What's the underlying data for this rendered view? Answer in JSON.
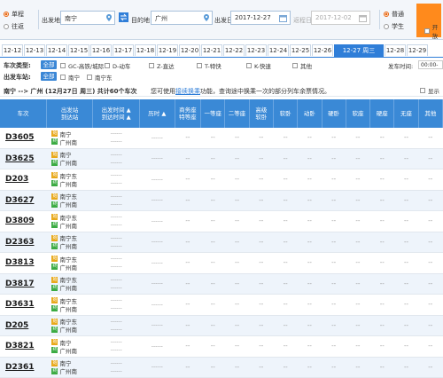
{
  "trip_type": {
    "options": [
      "单程",
      "往返"
    ],
    "selected": "单程"
  },
  "search": {
    "from_label": "出发地",
    "from_value": "南宁",
    "to_label": "目的地",
    "to_value": "广州",
    "depart_label": "出发日",
    "depart_value": "2017-12-27",
    "return_label": "返程日",
    "return_value": "2017-12-02"
  },
  "passenger": {
    "options": [
      "普通",
      "学生"
    ],
    "selected": "普通"
  },
  "top_right": {
    "label": "开放"
  },
  "dates": [
    "12-12",
    "12-13",
    "12-14",
    "12-15",
    "12-16",
    "12-17",
    "12-18",
    "12-19",
    "12-20",
    "12-21",
    "12-22",
    "12-23",
    "12-24",
    "12-25",
    "12-26",
    "12-27 周三",
    "12-28",
    "12-29"
  ],
  "active_date": "12-27 周三",
  "filters": {
    "type_title": "车次类型:",
    "all_label": "全部",
    "types": [
      "GC-高铁/城际",
      "D-动车",
      "Z-直达",
      "T-特快",
      "K-快速",
      "其他"
    ],
    "depart_time_label": "发车时间:",
    "depart_time_value": "00:00--2",
    "station_title": "出发车站:",
    "stations": [
      "南宁",
      "南宁东"
    ]
  },
  "summary": {
    "route": "南宁 --> 广州 (12月27日 周三) 共计60个车次",
    "hint_prefix": "您可使用",
    "hint_link": "接续换乘",
    "hint_suffix": "功能，查询途中换乘一次的部分列车余票情况。",
    "show_all": "显示"
  },
  "table": {
    "headers": [
      "车次",
      "出发站\n到达站",
      "出发时间 ▲\n到达时间 ▲",
      "历时 ▲",
      "商务座\n特等座",
      "一等座",
      "二等座",
      "高级\n软卧",
      "软卧",
      "动卧",
      "硬卧",
      "软座",
      "硬座",
      "无座",
      "其他"
    ],
    "rows": [
      {
        "no": "D3605",
        "from": "南宁",
        "to": "广州南"
      },
      {
        "no": "D3625",
        "from": "南宁",
        "to": "广州南"
      },
      {
        "no": "D203",
        "from": "南宁东",
        "to": "广州南"
      },
      {
        "no": "D3627",
        "from": "南宁东",
        "to": "广州南"
      },
      {
        "no": "D3809",
        "from": "南宁东",
        "to": "广州南"
      },
      {
        "no": "D2363",
        "from": "南宁东",
        "to": "广州南"
      },
      {
        "no": "D3813",
        "from": "南宁东",
        "to": "广州南"
      },
      {
        "no": "D3817",
        "from": "南宁东",
        "to": "广州南"
      },
      {
        "no": "D3631",
        "from": "南宁东",
        "to": "广州南"
      },
      {
        "no": "D205",
        "from": "南宁东",
        "to": "广州南"
      },
      {
        "no": "D3821",
        "from": "南宁",
        "to": "广州南"
      },
      {
        "no": "D2361",
        "from": "南宁",
        "to": "广州南"
      }
    ],
    "placeholder": "--",
    "time_placeholder": "------"
  },
  "colors": {
    "primary": "#2f7ed8",
    "header": "#3a89d6",
    "accent": "#ff8a1c",
    "start": "#e8a91a",
    "end": "#3bab43"
  }
}
